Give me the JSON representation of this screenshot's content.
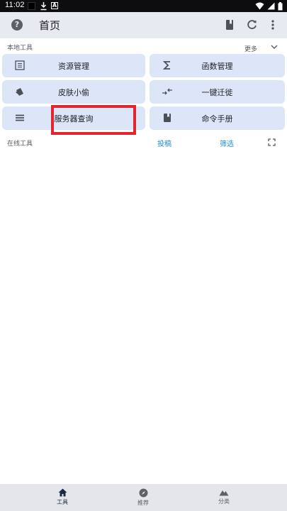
{
  "status_bar": {
    "time": "11:02"
  },
  "app_bar": {
    "title": "首页"
  },
  "local_tools": {
    "label": "本地工具",
    "more_label": "更多",
    "items": [
      {
        "label": "资源管理",
        "icon": "list-box-icon"
      },
      {
        "label": "函数管理",
        "icon": "sigma-icon"
      },
      {
        "label": "皮肤小偷",
        "icon": "skin-icon"
      },
      {
        "label": "一键迁徙",
        "icon": "swap-arrows-icon"
      },
      {
        "label": "服务器查询",
        "icon": "server-list-icon"
      },
      {
        "label": "命令手册",
        "icon": "book-icon"
      }
    ]
  },
  "online_tools": {
    "label": "在线工具",
    "submit_label": "投稿",
    "filter_label": "筛选"
  },
  "bottom_nav": {
    "items": [
      {
        "label": "工具",
        "icon": "home-icon",
        "active": true
      },
      {
        "label": "推荐",
        "icon": "compass-icon",
        "active": false
      },
      {
        "label": "分类",
        "icon": "mountain-icon",
        "active": false
      }
    ]
  },
  "colors": {
    "card_bg": "#dde5f8",
    "app_bar_bg": "#e7eaf1",
    "link_blue": "#1e8fd0",
    "highlight_red": "#e0262f"
  }
}
